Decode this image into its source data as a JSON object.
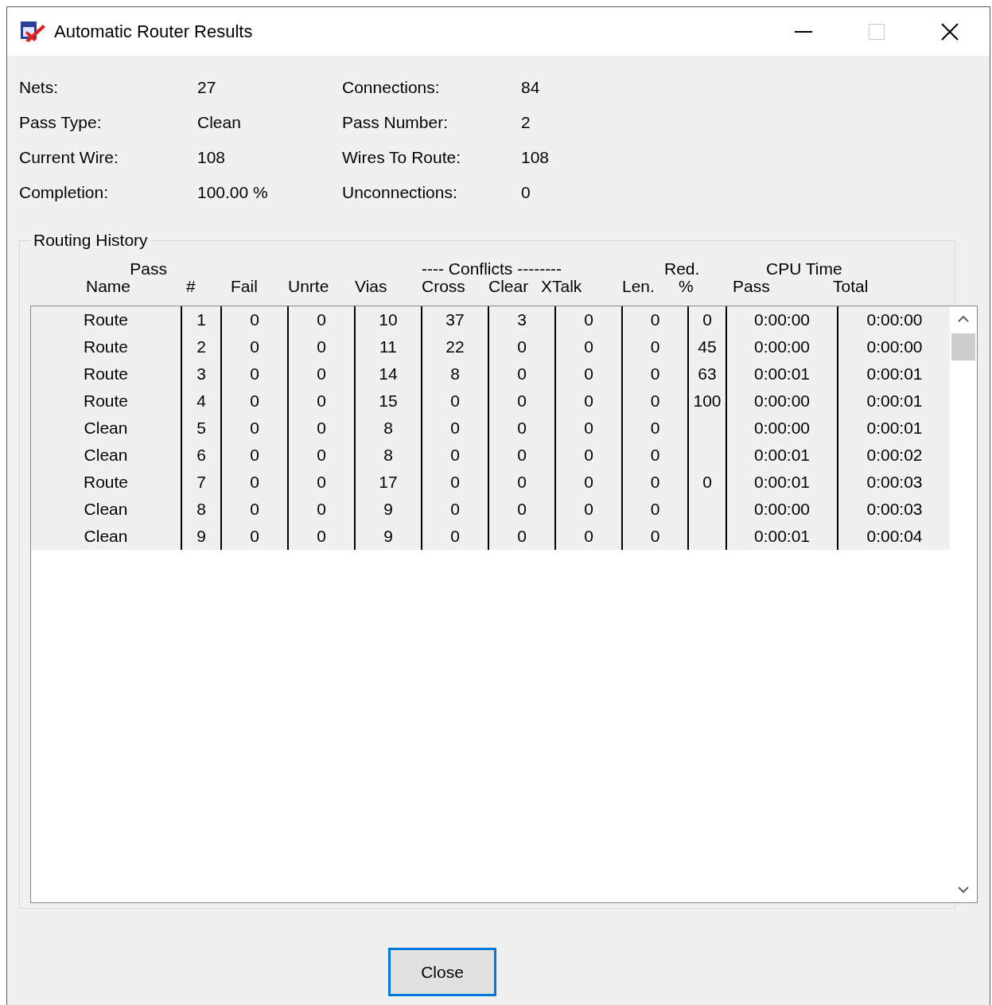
{
  "window": {
    "title": "Automatic Router Results"
  },
  "stats": [
    {
      "label": "Nets:",
      "value": "27"
    },
    {
      "label": "Connections:",
      "value": "84"
    },
    {
      "label": "Pass Type:",
      "value": "Clean"
    },
    {
      "label": "Pass Number:",
      "value": "2"
    },
    {
      "label": "Current Wire:",
      "value": "108"
    },
    {
      "label": "Wires To Route:",
      "value": "108"
    },
    {
      "label": "Completion:",
      "value": "100.00 %"
    },
    {
      "label": "Unconnections:",
      "value": "0"
    }
  ],
  "routing_history": {
    "title": "Routing History",
    "header_groups": [
      {
        "label": "Pass",
        "kind": "name"
      },
      {
        "label": "---- Conflicts --------",
        "kind": "conflicts"
      },
      {
        "label": "Red.",
        "kind": "red"
      },
      {
        "label": "CPU Time",
        "kind": "cpu"
      }
    ],
    "columns": [
      "Name",
      "#",
      "Fail",
      "Unrte",
      "Vias",
      "Cross",
      "Clear",
      "XTalk",
      "Len.",
      "%",
      "Pass",
      "Total"
    ],
    "rows": [
      {
        "cells": [
          "Route",
          "1",
          "0",
          "0",
          "10",
          "37",
          "3",
          "0",
          "0",
          "0",
          "0:00:00",
          "0:00:00"
        ]
      },
      {
        "cells": [
          "Route",
          "2",
          "0",
          "0",
          "11",
          "22",
          "0",
          "0",
          "0",
          "45",
          "0:00:00",
          "0:00:00"
        ]
      },
      {
        "cells": [
          "Route",
          "3",
          "0",
          "0",
          "14",
          "8",
          "0",
          "0",
          "0",
          "63",
          "0:00:01",
          "0:00:01"
        ]
      },
      {
        "cells": [
          "Route",
          "4",
          "0",
          "0",
          "15",
          "0",
          "0",
          "0",
          "0",
          "100",
          "0:00:00",
          "0:00:01"
        ]
      },
      {
        "cells": [
          "Clean",
          "5",
          "0",
          "0",
          "8",
          "0",
          "0",
          "0",
          "0",
          null,
          "0:00:00",
          "0:00:01"
        ]
      },
      {
        "cells": [
          "Clean",
          "6",
          "0",
          "0",
          "8",
          "0",
          "0",
          "0",
          "0",
          null,
          "0:00:01",
          "0:00:02"
        ]
      },
      {
        "cells": [
          "Route",
          "7",
          "0",
          "0",
          "17",
          "0",
          "0",
          "0",
          "0",
          "0",
          "0:00:01",
          "0:00:03"
        ]
      },
      {
        "cells": [
          "Clean",
          "8",
          "0",
          "0",
          "9",
          "0",
          "0",
          "0",
          "0",
          null,
          "0:00:00",
          "0:00:03"
        ]
      },
      {
        "cells": [
          "Clean",
          "9",
          "0",
          "0",
          "9",
          "0",
          "0",
          "0",
          "0",
          null,
          "0:00:01",
          "0:00:04"
        ]
      }
    ]
  },
  "buttons": [
    {
      "label": "Close",
      "focused": true
    }
  ]
}
